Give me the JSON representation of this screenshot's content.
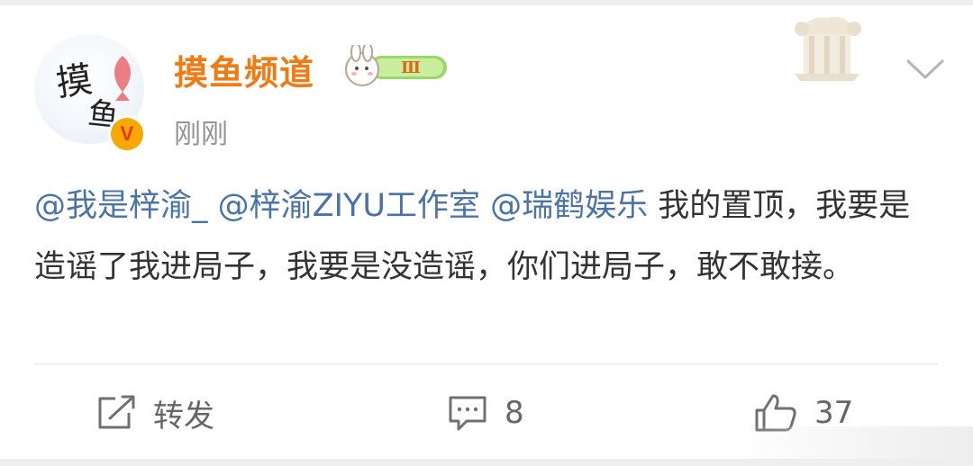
{
  "post": {
    "username": "摸鱼频道",
    "fan_level": "Ⅲ",
    "timestamp": "刚刚",
    "avatar_text": [
      "摸",
      "鱼"
    ],
    "verified_mark": "V",
    "mentions": [
      "@我是梓渝_",
      "@梓渝ZIYU工作室",
      "@瑞鹤娱乐"
    ],
    "body_text": " 我的置顶，我要是造谣了我进局子，我要是没造谣，你们进局子，敢不敢接。"
  },
  "actions": {
    "repost_label": "转发",
    "comment_count": "8",
    "like_count": "37"
  },
  "colors": {
    "username": "#f07b14",
    "mention": "#4a73a8",
    "body": "#333333",
    "secondary": "#939393",
    "badge": "#f8a800"
  }
}
